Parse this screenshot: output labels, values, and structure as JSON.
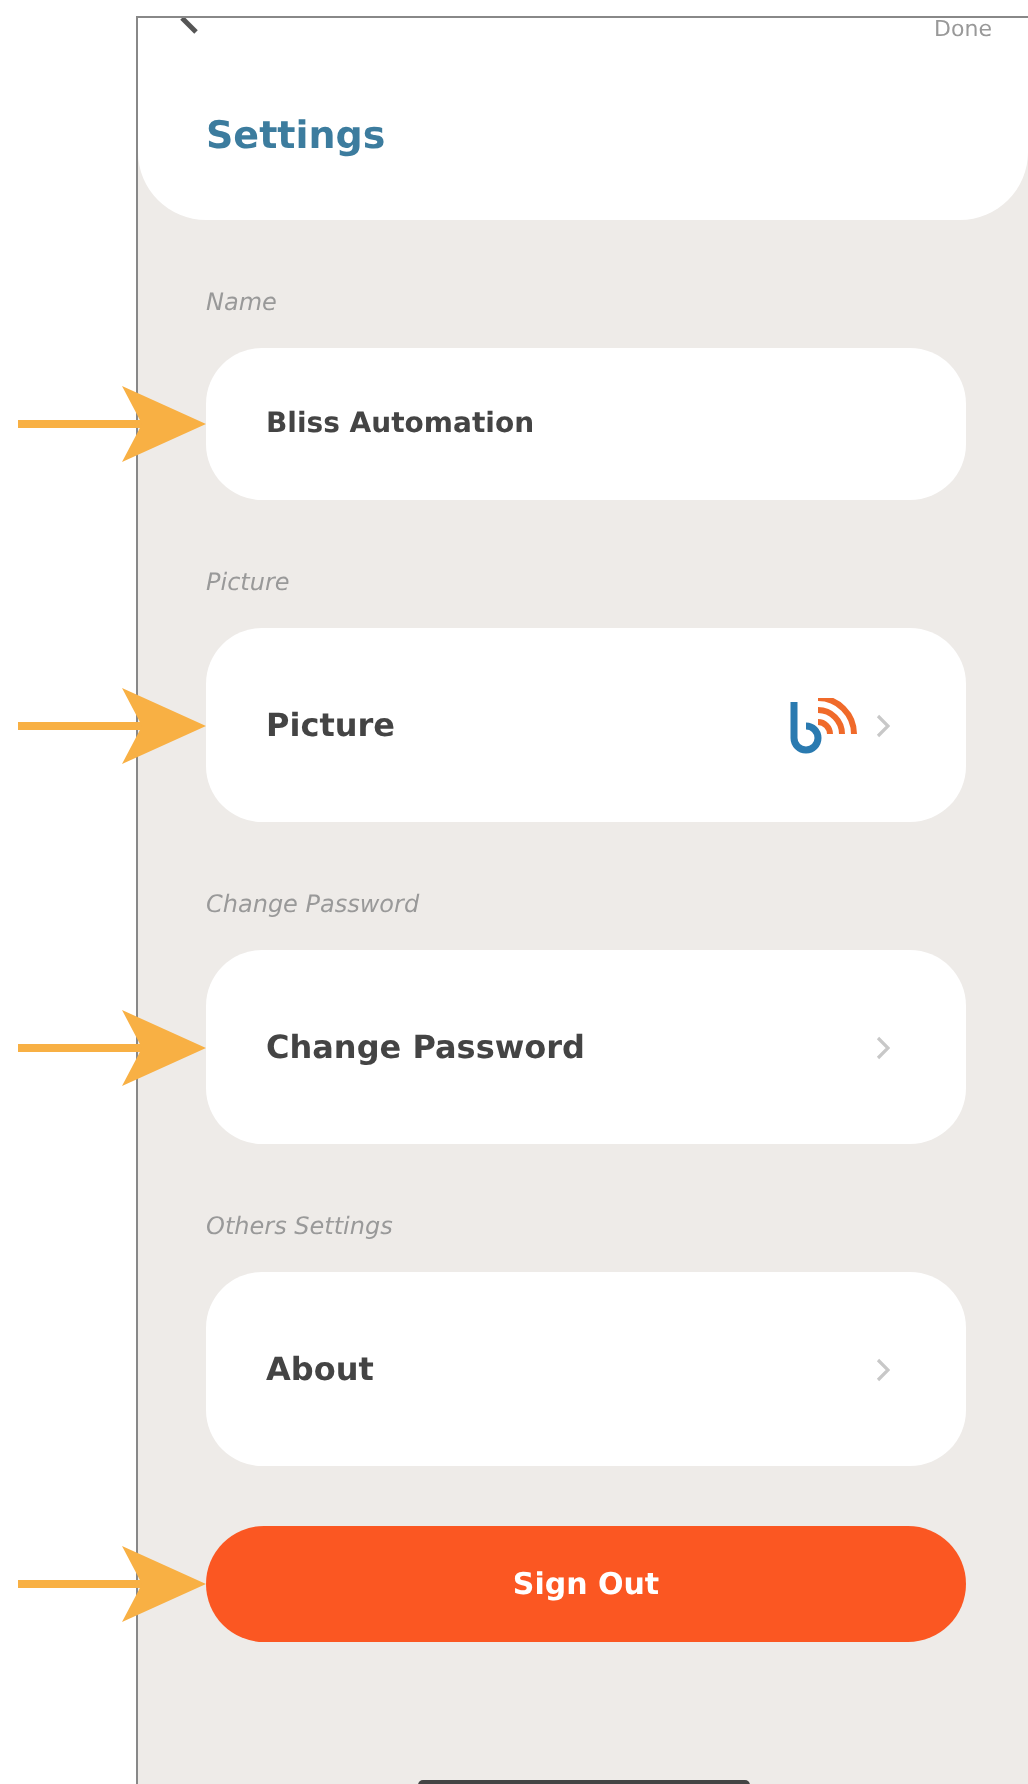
{
  "header": {
    "done": "Done",
    "title": "Settings"
  },
  "sections": [
    {
      "label": "Name",
      "kind": "text",
      "value": "Bliss Automation",
      "annotated": true
    },
    {
      "label": "Picture",
      "kind": "picture",
      "value": "Picture",
      "annotated": true
    },
    {
      "label": "Change Password",
      "kind": "link",
      "value": "Change Password",
      "annotated": true
    },
    {
      "label": "Others Settings",
      "kind": "link",
      "value": "About",
      "annotated": false
    }
  ],
  "sign_out": {
    "label": "Sign Out",
    "annotated": true
  }
}
